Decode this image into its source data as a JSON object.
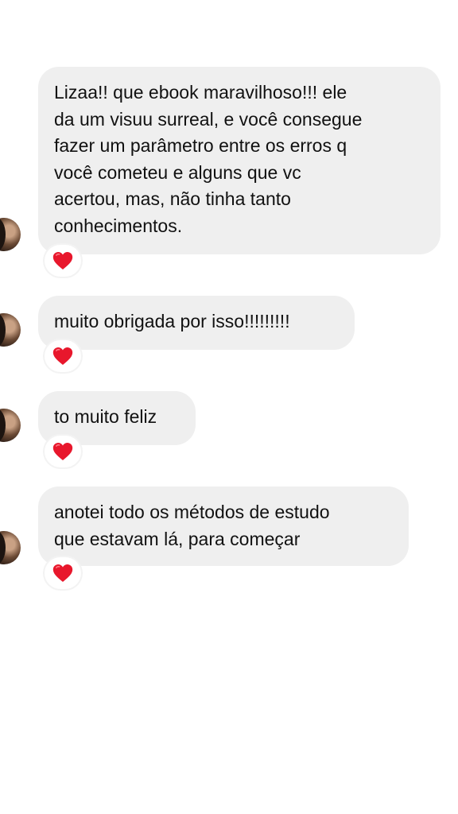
{
  "messages": [
    {
      "lines": [
        "Lizaa!! que ebook maravilhoso!!! ele",
        "da um visuu surreal, e você consegue",
        "fazer um parâmetro entre os erros q",
        "você cometeu e alguns que vc",
        "acertou, mas, não tinha tanto",
        "conhecimentos."
      ],
      "reaction": "red-heart"
    },
    {
      "lines": [
        "muito obrigada por isso!!!!!!!!!"
      ],
      "reaction": "red-heart"
    },
    {
      "lines": [
        "to muito feliz"
      ],
      "reaction": "red-heart"
    },
    {
      "lines": [
        "anotei todo os métodos de estudo",
        "que estavam lá, para começar"
      ],
      "reaction": "red-heart"
    }
  ],
  "colors": {
    "bubble_background": "#efefef",
    "text": "#111111",
    "heart": "#e8172c",
    "page_background": "#ffffff"
  },
  "icons": {
    "avatar": "sender-avatar",
    "reaction": "heart-icon"
  }
}
